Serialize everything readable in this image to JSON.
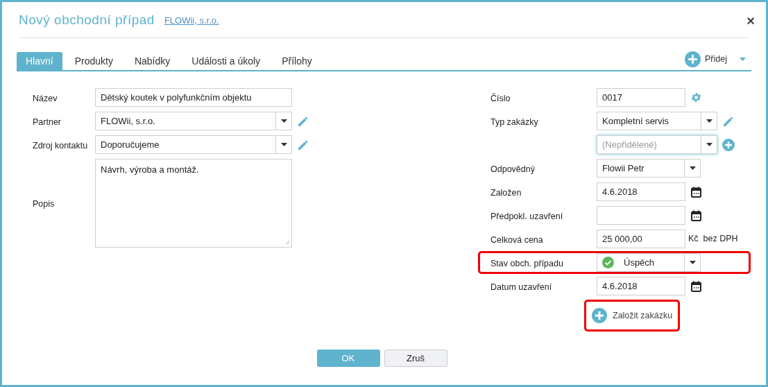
{
  "dialog": {
    "title": "Nový obchodní případ",
    "partner_link": "FLOWii, s.r.o.",
    "close": "×"
  },
  "tabs": [
    {
      "label": "Hlavní",
      "selected": true
    },
    {
      "label": "Produkty",
      "selected": false
    },
    {
      "label": "Nabídky",
      "selected": false
    },
    {
      "label": "Události a úkoly",
      "selected": false
    },
    {
      "label": "Přílohy",
      "selected": false
    }
  ],
  "add_menu": {
    "label": "Přidej"
  },
  "left_fields": [
    {
      "label": "Název",
      "kind": "text",
      "value": "Dětský koutek v polyfunkčním objektu"
    },
    {
      "label": "Partner",
      "kind": "select",
      "value": "FLOWii, s.r.o.",
      "action": {
        "kind": "edit"
      }
    },
    {
      "label": "Zdroj kontaktu",
      "kind": "select",
      "value": "Doporučujeme",
      "action": {
        "kind": "edit"
      }
    },
    {
      "label": "Popis",
      "kind": "textarea",
      "value": "Návrh, výroba a montáž."
    }
  ],
  "right_fields": [
    {
      "label": "Číslo",
      "kind": "text",
      "value": "0017",
      "action": {
        "kind": "settings"
      },
      "highlighted": false
    },
    {
      "label": "Typ zakázky",
      "kind": "select",
      "value": "Kompletní servis",
      "action": {
        "kind": "edit"
      },
      "highlighted": false
    },
    {
      "kind": "select",
      "placeholder": "(Nepřidělené)",
      "action": {
        "kind": "add"
      },
      "focused": true,
      "highlighted": false
    },
    {
      "label": "Odpovědný",
      "kind": "select",
      "value": "Flowii Petr",
      "highlighted": false
    },
    {
      "label": "Založen",
      "kind": "date",
      "value": "4.6.2018",
      "highlighted": false
    },
    {
      "label": "Předpokl. uzavření",
      "kind": "date",
      "highlighted": false
    },
    {
      "label": "Celková cena",
      "kind": "money",
      "value": "25 000,00",
      "unit": "Kč",
      "suffix": "bez DPH",
      "highlighted": false
    },
    {
      "label": "Stav obch. případu",
      "kind": "status",
      "value": "Úspěch",
      "highlighted": true
    },
    {
      "label": "Datum uzavření",
      "kind": "date",
      "value": "4.6.2018",
      "highlighted": false
    }
  ],
  "create_order": {
    "label": "Založit zakázku",
    "highlighted": true
  },
  "buttons": [
    {
      "label": "OK",
      "kind": "primary"
    },
    {
      "label": "Zruš",
      "kind": "secondary"
    }
  ]
}
